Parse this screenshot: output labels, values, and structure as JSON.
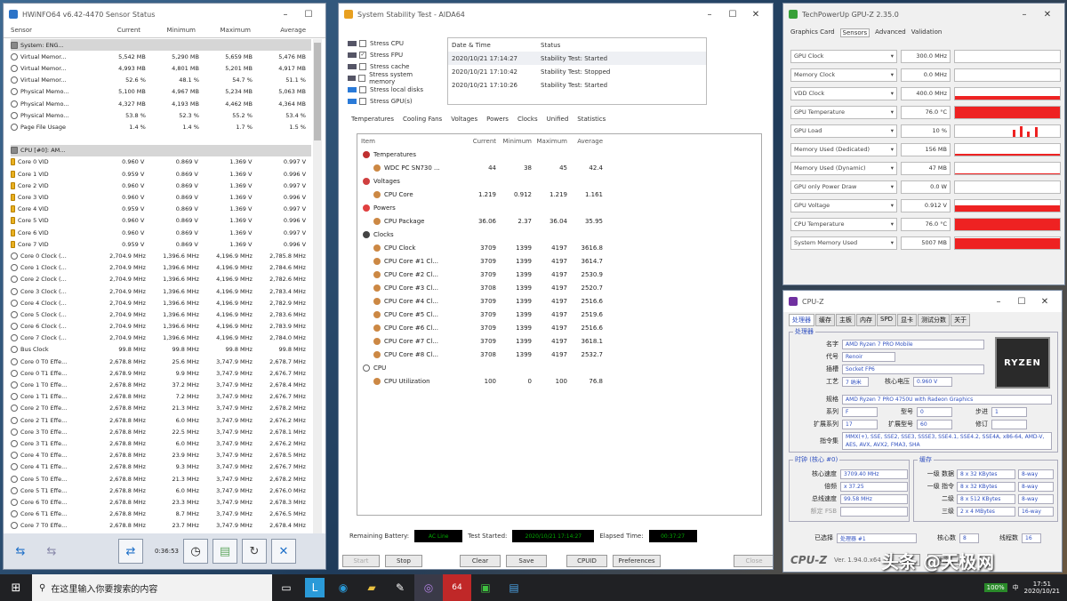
{
  "hwinfo": {
    "title": "HWiNFO64 v6.42-4470 Sensor Status",
    "cols": [
      "Sensor",
      "Current",
      "Minimum",
      "Maximum",
      "Average"
    ],
    "rows": [
      {
        "t": "g",
        "c": [
          "System: ENG...",
          "",
          "",
          "",
          ""
        ]
      },
      {
        "t": "r",
        "c": [
          "Virtual Memor...",
          "5,542 MB",
          "5,290 MB",
          "5,659 MB",
          "5,476 MB"
        ]
      },
      {
        "t": "r",
        "c": [
          "Virtual Memor...",
          "4,993 MB",
          "4,801 MB",
          "5,201 MB",
          "4,917 MB"
        ]
      },
      {
        "t": "r",
        "c": [
          "Virtual Memor...",
          "52.6 %",
          "48.1 %",
          "54.7 %",
          "51.1 %"
        ]
      },
      {
        "t": "r",
        "c": [
          "Physical Memo...",
          "5,100 MB",
          "4,967 MB",
          "5,234 MB",
          "5,063 MB"
        ]
      },
      {
        "t": "r",
        "c": [
          "Physical Memo...",
          "4,327 MB",
          "4,193 MB",
          "4,462 MB",
          "4,364 MB"
        ]
      },
      {
        "t": "r",
        "c": [
          "Physical Memo...",
          "53.8 %",
          "52.3 %",
          "55.2 %",
          "53.4 %"
        ]
      },
      {
        "t": "r",
        "c": [
          "Page File Usage",
          "1.4 %",
          "1.4 %",
          "1.7 %",
          "1.5 %"
        ]
      },
      {
        "t": "s",
        "c": [
          "",
          "",
          "",
          "",
          ""
        ]
      },
      {
        "t": "g",
        "c": [
          "CPU [#0]: AM...",
          "",
          "",
          "",
          ""
        ]
      },
      {
        "t": "y",
        "c": [
          "Core 0 VID",
          "0.960 V",
          "0.869 V",
          "1.369 V",
          "0.997 V"
        ]
      },
      {
        "t": "y",
        "c": [
          "Core 1 VID",
          "0.959 V",
          "0.869 V",
          "1.369 V",
          "0.996 V"
        ]
      },
      {
        "t": "y",
        "c": [
          "Core 2 VID",
          "0.960 V",
          "0.869 V",
          "1.369 V",
          "0.997 V"
        ]
      },
      {
        "t": "y",
        "c": [
          "Core 3 VID",
          "0.960 V",
          "0.869 V",
          "1.369 V",
          "0.996 V"
        ]
      },
      {
        "t": "y",
        "c": [
          "Core 4 VID",
          "0.959 V",
          "0.869 V",
          "1.369 V",
          "0.997 V"
        ]
      },
      {
        "t": "y",
        "c": [
          "Core 5 VID",
          "0.960 V",
          "0.869 V",
          "1.369 V",
          "0.996 V"
        ]
      },
      {
        "t": "y",
        "c": [
          "Core 6 VID",
          "0.960 V",
          "0.869 V",
          "1.369 V",
          "0.997 V"
        ]
      },
      {
        "t": "y",
        "c": [
          "Core 7 VID",
          "0.959 V",
          "0.869 V",
          "1.369 V",
          "0.996 V"
        ]
      },
      {
        "t": "r",
        "c": [
          "Core 0 Clock (...",
          "2,704.9 MHz",
          "1,396.6 MHz",
          "4,196.9 MHz",
          "2,785.8 MHz"
        ]
      },
      {
        "t": "r",
        "c": [
          "Core 1 Clock (...",
          "2,704.9 MHz",
          "1,396.6 MHz",
          "4,196.9 MHz",
          "2,784.6 MHz"
        ]
      },
      {
        "t": "r",
        "c": [
          "Core 2 Clock (...",
          "2,704.9 MHz",
          "1,396.6 MHz",
          "4,196.9 MHz",
          "2,782.6 MHz"
        ]
      },
      {
        "t": "r",
        "c": [
          "Core 3 Clock (...",
          "2,704.9 MHz",
          "1,396.6 MHz",
          "4,196.9 MHz",
          "2,783.4 MHz"
        ]
      },
      {
        "t": "r",
        "c": [
          "Core 4 Clock (...",
          "2,704.9 MHz",
          "1,396.6 MHz",
          "4,196.9 MHz",
          "2,782.9 MHz"
        ]
      },
      {
        "t": "r",
        "c": [
          "Core 5 Clock (...",
          "2,704.9 MHz",
          "1,396.6 MHz",
          "4,196.9 MHz",
          "2,783.6 MHz"
        ]
      },
      {
        "t": "r",
        "c": [
          "Core 6 Clock (...",
          "2,704.9 MHz",
          "1,396.6 MHz",
          "4,196.9 MHz",
          "2,783.9 MHz"
        ]
      },
      {
        "t": "r",
        "c": [
          "Core 7 Clock (...",
          "2,704.9 MHz",
          "1,396.6 MHz",
          "4,196.9 MHz",
          "2,784.0 MHz"
        ]
      },
      {
        "t": "r",
        "c": [
          "Bus Clock",
          "99.8 MHz",
          "99.8 MHz",
          "99.8 MHz",
          "99.8 MHz"
        ]
      },
      {
        "t": "r",
        "c": [
          "Core 0 T0 Effe...",
          "2,678.8 MHz",
          "25.6 MHz",
          "3,747.9 MHz",
          "2,678.7 MHz"
        ]
      },
      {
        "t": "r",
        "c": [
          "Core 0 T1 Effe...",
          "2,678.9 MHz",
          "9.9 MHz",
          "3,747.9 MHz",
          "2,676.7 MHz"
        ]
      },
      {
        "t": "r",
        "c": [
          "Core 1 T0 Effe...",
          "2,678.8 MHz",
          "37.2 MHz",
          "3,747.9 MHz",
          "2,678.4 MHz"
        ]
      },
      {
        "t": "r",
        "c": [
          "Core 1 T1 Effe...",
          "2,678.8 MHz",
          "7.2 MHz",
          "3,747.9 MHz",
          "2,676.7 MHz"
        ]
      },
      {
        "t": "r",
        "c": [
          "Core 2 T0 Effe...",
          "2,678.8 MHz",
          "21.3 MHz",
          "3,747.9 MHz",
          "2,678.2 MHz"
        ]
      },
      {
        "t": "r",
        "c": [
          "Core 2 T1 Effe...",
          "2,678.8 MHz",
          "6.0 MHz",
          "3,747.9 MHz",
          "2,676.2 MHz"
        ]
      },
      {
        "t": "r",
        "c": [
          "Core 3 T0 Effe...",
          "2,678.8 MHz",
          "22.5 MHz",
          "3,747.9 MHz",
          "2,678.1 MHz"
        ]
      },
      {
        "t": "r",
        "c": [
          "Core 3 T1 Effe...",
          "2,678.8 MHz",
          "6.0 MHz",
          "3,747.9 MHz",
          "2,676.2 MHz"
        ]
      },
      {
        "t": "r",
        "c": [
          "Core 4 T0 Effe...",
          "2,678.8 MHz",
          "23.9 MHz",
          "3,747.9 MHz",
          "2,678.5 MHz"
        ]
      },
      {
        "t": "r",
        "c": [
          "Core 4 T1 Effe...",
          "2,678.8 MHz",
          "9.3 MHz",
          "3,747.9 MHz",
          "2,676.7 MHz"
        ]
      },
      {
        "t": "r",
        "c": [
          "Core 5 T0 Effe...",
          "2,678.8 MHz",
          "21.3 MHz",
          "3,747.9 MHz",
          "2,678.2 MHz"
        ]
      },
      {
        "t": "r",
        "c": [
          "Core 5 T1 Effe...",
          "2,678.8 MHz",
          "6.0 MHz",
          "3,747.9 MHz",
          "2,676.0 MHz"
        ]
      },
      {
        "t": "r",
        "c": [
          "Core 6 T0 Effe...",
          "2,678.8 MHz",
          "23.3 MHz",
          "3,747.9 MHz",
          "2,678.3 MHz"
        ]
      },
      {
        "t": "r",
        "c": [
          "Core 6 T1 Effe...",
          "2,678.8 MHz",
          "8.7 MHz",
          "3,747.9 MHz",
          "2,676.5 MHz"
        ]
      },
      {
        "t": "r",
        "c": [
          "Core 7 T0 Effe...",
          "2,678.8 MHz",
          "23.7 MHz",
          "3,747.9 MHz",
          "2,678.4 MHz"
        ]
      },
      {
        "t": "r",
        "c": [
          "Core 7 T1 Effe...",
          "2,678.8 MHz",
          "6.6 MHz",
          "3,747.9 MHz",
          "2,676.4 MHz"
        ]
      }
    ],
    "timer": "0:36:53"
  },
  "aida": {
    "title": "System Stability Test - AIDA64",
    "stress": [
      "Stress CPU",
      "Stress FPU",
      "Stress cache",
      "Stress system memory",
      "Stress local disks",
      "Stress GPU(s)"
    ],
    "log_header": [
      "Date & Time",
      "Status"
    ],
    "log": [
      [
        "2020/10/21 17:14:27",
        "Stability Test: Started"
      ],
      [
        "2020/10/21 17:10:42",
        "Stability Test: Stopped"
      ],
      [
        "2020/10/21 17:10:26",
        "Stability Test: Started"
      ]
    ],
    "tabs": [
      "Temperatures",
      "Cooling Fans",
      "Voltages",
      "Powers",
      "Clocks",
      "Unified",
      "Statistics"
    ],
    "stat_header": [
      "Item",
      "Current",
      "Minimum",
      "Maximum",
      "Average"
    ],
    "stats": [
      [
        "g",
        "Temperatures",
        "",
        "",
        "",
        ""
      ],
      [
        "i",
        "WDC PC SN730 ...",
        "44",
        "38",
        "45",
        "42.4"
      ],
      [
        "g",
        "Voltages",
        "",
        "",
        "",
        ""
      ],
      [
        "i",
        "CPU Core",
        "1.219",
        "0.912",
        "1.219",
        "1.161"
      ],
      [
        "g",
        "Powers",
        "",
        "",
        "",
        ""
      ],
      [
        "i",
        "CPU Package",
        "36.06",
        "2.37",
        "36.04",
        "35.95"
      ],
      [
        "g",
        "Clocks",
        "",
        "",
        "",
        ""
      ],
      [
        "i",
        "CPU Clock",
        "3709",
        "1399",
        "4197",
        "3616.8"
      ],
      [
        "i",
        "CPU Core #1 Cl...",
        "3709",
        "1399",
        "4197",
        "3614.7"
      ],
      [
        "i",
        "CPU Core #2 Cl...",
        "3709",
        "1399",
        "4197",
        "2530.9"
      ],
      [
        "i",
        "CPU Core #3 Cl...",
        "3708",
        "1399",
        "4197",
        "2520.7"
      ],
      [
        "i",
        "CPU Core #4 Cl...",
        "3709",
        "1399",
        "4197",
        "2516.6"
      ],
      [
        "i",
        "CPU Core #5 Cl...",
        "3709",
        "1399",
        "4197",
        "2519.6"
      ],
      [
        "i",
        "CPU Core #6 Cl...",
        "3709",
        "1399",
        "4197",
        "2516.6"
      ],
      [
        "i",
        "CPU Core #7 Cl...",
        "3709",
        "1399",
        "4197",
        "3618.1"
      ],
      [
        "i",
        "CPU Core #8 Cl...",
        "3708",
        "1399",
        "4197",
        "2532.7"
      ],
      [
        "g",
        "CPU",
        "",
        "",
        "",
        ""
      ],
      [
        "i",
        "CPU Utilization",
        "100",
        "0",
        "100",
        "76.8"
      ]
    ],
    "remaining_label": "Remaining Battery:",
    "remaining_val": "AC Line",
    "started_label": "Test Started:",
    "started_val": "2020/10/21 17:14:27",
    "elapsed_label": "Elapsed Time:",
    "elapsed_val": "00:37:27",
    "buttons": [
      "Start",
      "Stop",
      "Clear",
      "Save",
      "CPUID",
      "Preferences",
      "Close"
    ]
  },
  "gpuz": {
    "title": "TechPowerUp GPU-Z 2.35.0",
    "tabs": [
      "Graphics Card",
      "Sensors",
      "Advanced",
      "Validation"
    ],
    "sensors": [
      [
        "GPU Clock",
        "300.0 MHz",
        0.0
      ],
      [
        "Memory Clock",
        "0.0 MHz",
        0.0
      ],
      [
        "VDD Clock",
        "400.0 MHz",
        0.25
      ],
      [
        "GPU Temperature",
        "76.0 °C",
        0.95
      ],
      [
        "GPU Load",
        "10 %",
        0.18
      ],
      [
        "Memory Used (Dedicated)",
        "156 MB",
        0.1
      ],
      [
        "Memory Used (Dynamic)",
        "47 MB",
        0.05
      ],
      [
        "GPU only Power Draw",
        "0.0 W",
        0.0
      ],
      [
        "GPU Voltage",
        "0.912 V",
        0.5
      ],
      [
        "CPU Temperature",
        "76.0 °C",
        0.95
      ],
      [
        "System Memory Used",
        "5007 MB",
        0.9
      ]
    ]
  },
  "cpuz": {
    "title": "CPU-Z",
    "tabs": [
      "处理器",
      "缓存",
      "主板",
      "内存",
      "SPD",
      "显卡",
      "测试分数",
      "关于"
    ],
    "proc_legend": "处理器",
    "name_k": "名字",
    "name_v": "AMD Ryzen 7 PRO Mobile",
    "code_k": "代号",
    "code_v": "Renoir",
    "brand_k": "商标",
    "sock_k": "插槽",
    "sock_v": "Socket FP6",
    "tech_k": "工艺",
    "tech_v": "7 纳米",
    "volt_k": "核心电压",
    "volt_v": "0.960 V",
    "spec_k": "规格",
    "spec_v": "AMD Ryzen 7 PRO 4750U with Radeon Graphics",
    "fam_k": "系列",
    "fam_v": "F",
    "model_k": "型号",
    "model_v": "0",
    "step_k": "步进",
    "step_v": "1",
    "efam_k": "扩展系列",
    "efam_v": "17",
    "emodel_k": "扩展型号",
    "emodel_v": "60",
    "rev_k": "修订",
    "rev_v": "",
    "inst_k": "指令集",
    "inst_v": "MMX(+), SSE, SSE2, SSE3, SSSE3, SSE4.1, SSE4.2, SSE4A, x86-64, AMD-V, AES, AVX, AVX2, FMA3, SHA",
    "clk_legend": "时钟 (核心 #0)",
    "cspd_k": "核心速度",
    "cspd_v": "3709.40 MHz",
    "mult_k": "倍频",
    "mult_v": "x 37.25",
    "bus_k": "总线速度",
    "bus_v": "99.58 MHz",
    "fsb_k": "额定 FSB",
    "fsb_v": "",
    "cache_legend": "缓存",
    "l1d_k": "一级 数据",
    "l1d_v": "8 x 32 KBytes",
    "l1d_w": "8-way",
    "l1i_k": "一级 指令",
    "l1i_v": "8 x 32 KBytes",
    "l1i_w": "8-way",
    "l2_k": "二级",
    "l2_v": "8 x 512 KBytes",
    "l2_w": "8-way",
    "l3_k": "三级",
    "l3_v": "2 x 4 MBytes",
    "l3_w": "16-way",
    "sel_k": "已选择",
    "sel_v": "处理器 #1",
    "cores_k": "核心数",
    "cores_v": "8",
    "thr_k": "线程数",
    "thr_v": "16",
    "logo": "CPU-Z",
    "ver": "Ver. 1.94.0.x64",
    "tools": "工具",
    "ok": "确定",
    "ryzen": "RYZEN"
  },
  "taskbar": {
    "search": "在这里输入你要搜索的内容",
    "time": "17:51",
    "date": "2020/10/21",
    "lang": "中",
    "battery": "100%"
  },
  "watermark": "头条 @天极网"
}
